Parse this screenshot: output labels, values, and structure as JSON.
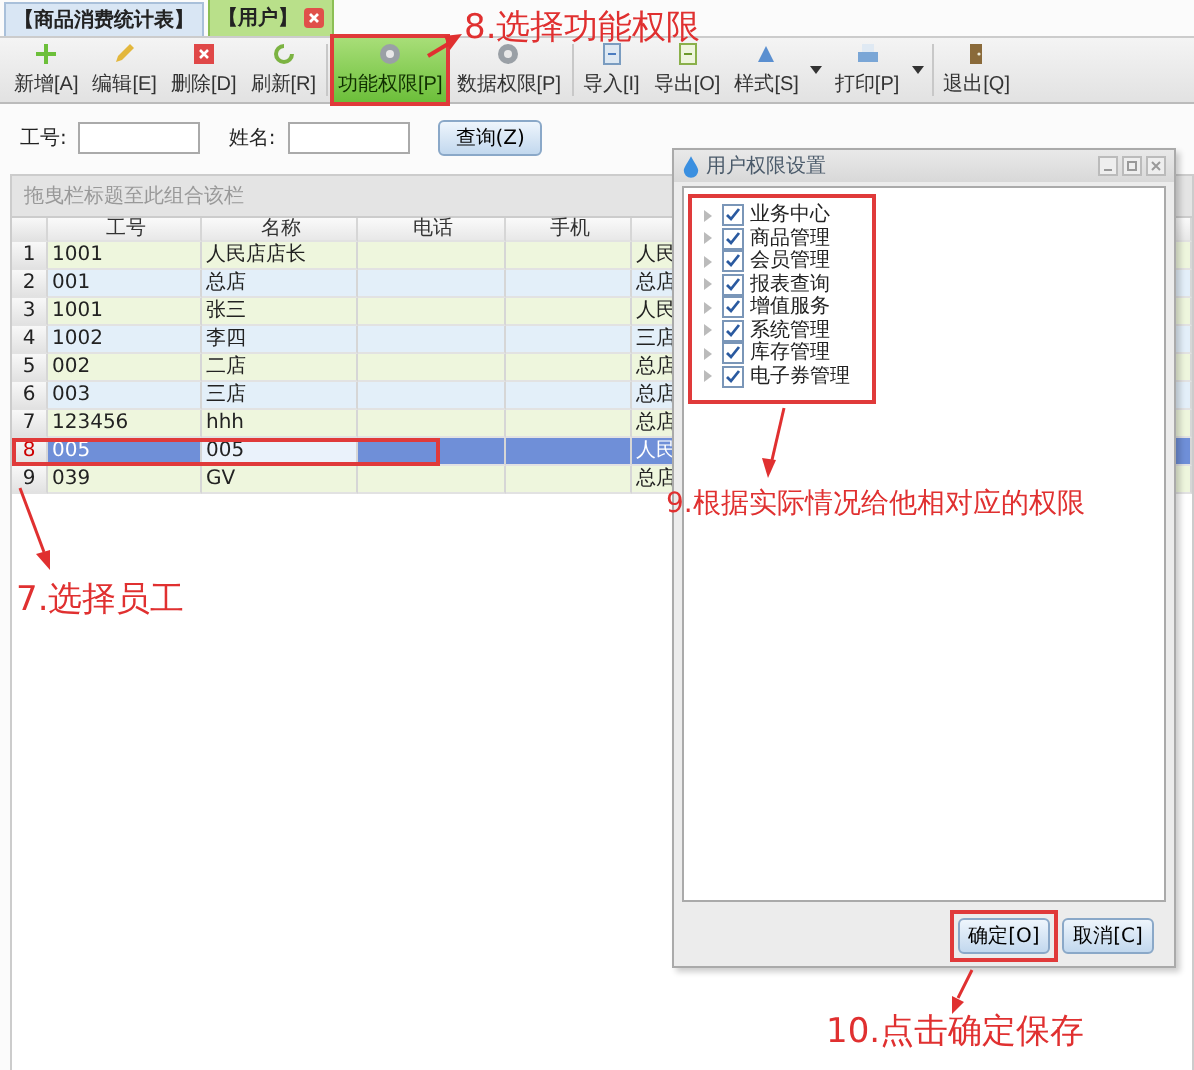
{
  "tabs": [
    {
      "label": "【商品消费统计表】",
      "selected": false,
      "closable": false
    },
    {
      "label": "【用户】",
      "selected": true,
      "closable": true
    }
  ],
  "toolbar": [
    {
      "label": "新增[A]",
      "selected": false,
      "menu": false
    },
    {
      "label": "编辑[E]",
      "selected": false,
      "menu": false
    },
    {
      "label": "删除[D]",
      "selected": false,
      "menu": false
    },
    {
      "label": "刷新[R]",
      "selected": false,
      "menu": false
    },
    {
      "label": "功能权限[P]",
      "selected": true,
      "menu": false
    },
    {
      "label": "数据权限[P]",
      "selected": false,
      "menu": false
    },
    {
      "label": "导入[I]",
      "selected": false,
      "menu": false
    },
    {
      "label": "导出[O]",
      "selected": false,
      "menu": false
    },
    {
      "label": "样式[S]",
      "selected": false,
      "menu": true
    },
    {
      "label": "打印[P]",
      "selected": false,
      "menu": true
    },
    {
      "label": "退出[Q]",
      "selected": false,
      "menu": false
    }
  ],
  "search": {
    "fields": [
      {
        "label": "工号:"
      },
      {
        "label": "姓名:"
      }
    ],
    "button": "查询(Z)"
  },
  "grid": {
    "group_hint": "拖曳栏标题至此组合该栏",
    "columns": [
      "工号",
      "名称",
      "电话",
      "手机"
    ],
    "rows": [
      {
        "number": "1",
        "cells": [
          "1001",
          "人民店店长",
          "",
          "",
          "人民"
        ],
        "selected": false
      },
      {
        "number": "2",
        "cells": [
          "001",
          "总店",
          "",
          "",
          "总店"
        ],
        "selected": false
      },
      {
        "number": "3",
        "cells": [
          "1001",
          "张三",
          "",
          "",
          "人民"
        ],
        "selected": false
      },
      {
        "number": "4",
        "cells": [
          "1002",
          "李四",
          "",
          "",
          "三店"
        ],
        "selected": false
      },
      {
        "number": "5",
        "cells": [
          "002",
          "二店",
          "",
          "",
          "总店"
        ],
        "selected": false
      },
      {
        "number": "6",
        "cells": [
          "003",
          "三店",
          "",
          "",
          "总店"
        ],
        "selected": false
      },
      {
        "number": "7",
        "cells": [
          "123456",
          "hhh",
          "",
          "",
          "总店"
        ],
        "selected": false
      },
      {
        "number": "8",
        "cells": [
          "005",
          "005",
          "",
          "",
          "人民"
        ],
        "selected": true
      },
      {
        "number": "9",
        "cells": [
          "039",
          "GV",
          "",
          "",
          "总店"
        ],
        "selected": false
      }
    ]
  },
  "dialog": {
    "title": "用户权限设置",
    "tree": [
      {
        "label": "业务中心",
        "checked": true
      },
      {
        "label": "商品管理",
        "checked": true
      },
      {
        "label": "会员管理",
        "checked": true
      },
      {
        "label": "报表查询",
        "checked": true
      },
      {
        "label": "增值服务",
        "checked": true
      },
      {
        "label": "系统管理",
        "checked": true
      },
      {
        "label": "库存管理",
        "checked": true
      },
      {
        "label": "电子券管理",
        "checked": true
      }
    ],
    "buttons": [
      "确定[O]",
      "取消[C]"
    ]
  },
  "annotations": [
    "8.选择功能权限",
    "9.根据实际情况给他相对应的权限",
    "7.选择员工",
    "10.点击确定保存"
  ]
}
